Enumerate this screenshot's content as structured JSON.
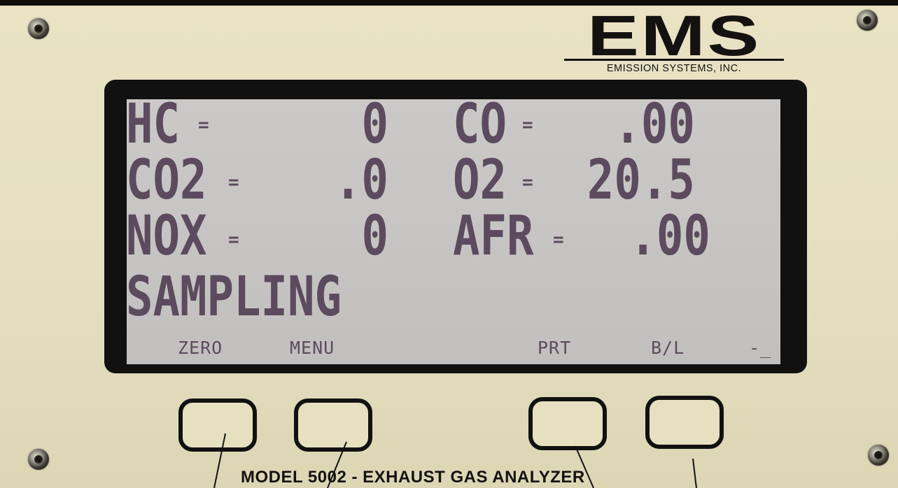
{
  "brand": {
    "logo_letters": "EMS",
    "company": "EMISSION SYSTEMS, INC."
  },
  "display": {
    "readings": [
      {
        "label": "HC",
        "value": "0"
      },
      {
        "label": "CO",
        "value": ".00"
      },
      {
        "label": "CO2",
        "value": ".0"
      },
      {
        "label": "O2",
        "value": "20.5"
      },
      {
        "label": "NOX",
        "value": "0"
      },
      {
        "label": "AFR",
        "value": ".00"
      }
    ],
    "status": "SAMPLING",
    "softkeys": [
      "ZERO",
      "MENU",
      "PRT",
      "B/L"
    ],
    "cursor": "-_"
  },
  "model_label": "MODEL 5002 - EXHAUST GAS ANALYZER",
  "colors": {
    "lcd_background": "#c8c6c4",
    "lcd_text": "#5c4b5e",
    "panel": "#e6e0c1",
    "bezel": "#111111"
  }
}
